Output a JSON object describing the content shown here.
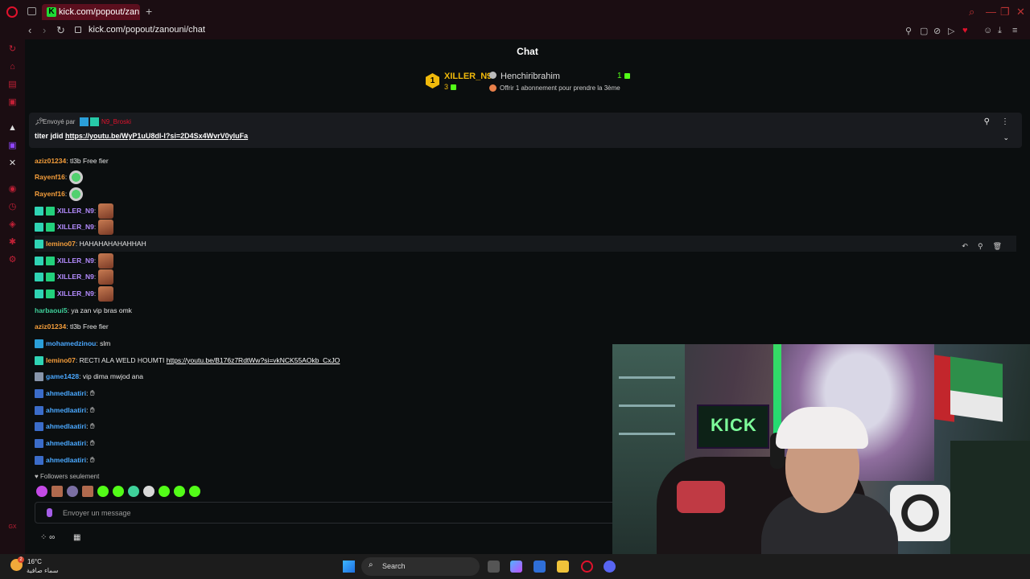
{
  "browser": {
    "tab_title": "kick.com/popout/zanouni/",
    "tab_favicon": "K",
    "url": "kick.com/popout/zanouni/chat",
    "new_tab": "+"
  },
  "chat": {
    "title": "Chat",
    "leaderboard": {
      "rank": "1",
      "top_user": "XILLER_N9",
      "top_count": "3",
      "second_user": "Henchiribrahim",
      "second_score": "1",
      "subscription_prompt": "Offrir 1 abonnement pour prendre la 3ème"
    },
    "pinned": {
      "sent_by_label": "Envoyé par",
      "sent_by_user": "N9_Broski",
      "text_prefix": "titer jdid ",
      "link": "https://youtu.be/WyP1uU8dl-I?si=2D4Sx4WvrV0yluFa"
    },
    "messages": [
      {
        "user": "aziz01234",
        "color": "#f59e3b",
        "text": ": tl3b Free fier"
      },
      {
        "user": "Rayenf16",
        "color": "#f59e3b",
        "text": ":"
      },
      {
        "user": "Rayenf16",
        "color": "#f59e3b",
        "text": ":"
      },
      {
        "user": "XILLER_N9",
        "color": "#b48cff",
        "text": ":"
      },
      {
        "user": "XILLER_N9",
        "color": "#b48cff",
        "text": ":"
      },
      {
        "user": "lemino07",
        "color": "#f59e3b",
        "text": ": HAHAHAHAHAHHAH"
      },
      {
        "user": "XILLER_N9",
        "color": "#b48cff",
        "text": ":"
      },
      {
        "user": "XILLER_N9",
        "color": "#b48cff",
        "text": ":"
      },
      {
        "user": "XILLER_N9",
        "color": "#b48cff",
        "text": ":"
      },
      {
        "user": "harbaoui5",
        "color": "#3fd19b",
        "text": ": ya zan vip bras omk"
      },
      {
        "user": "aziz01234",
        "color": "#f59e3b",
        "text": ": tl3b Free fier"
      },
      {
        "user": "mohamedzinou",
        "color": "#4aa8ff",
        "text": ": slm"
      },
      {
        "user": "lemino07",
        "color": "#f59e3b",
        "text": ": RECTI ALA WELD HOUMTI ",
        "link": "https://youtu.be/B176z7RdtWw?si=vkNCK55AOkb_CxJO"
      },
      {
        "user": "game1428",
        "color": "#4aa8ff",
        "text": ": vip dima mwjod ana"
      },
      {
        "user": "ahmedlaatiri",
        "color": "#4aa8ff",
        "text": ":"
      },
      {
        "user": "ahmedlaatiri",
        "color": "#4aa8ff",
        "text": ":"
      },
      {
        "user": "ahmedlaatiri",
        "color": "#4aa8ff",
        "text": ":"
      },
      {
        "user": "ahmedlaatiri",
        "color": "#4aa8ff",
        "text": ":"
      },
      {
        "user": "ahmedlaatiri",
        "color": "#4aa8ff",
        "text": ":"
      }
    ],
    "followers_only": "Followers seulement",
    "input_placeholder": "Envoyer un message"
  },
  "webcam": {
    "sign_text": "KICK"
  },
  "taskbar": {
    "weather_temp": "16°C",
    "weather_desc": "سماء صافية",
    "weather_badge": "2",
    "search_label": "Search"
  },
  "colors": {
    "accent_green": "#53fc18",
    "opera_red": "#e0122c",
    "gold": "#f0b90b"
  }
}
